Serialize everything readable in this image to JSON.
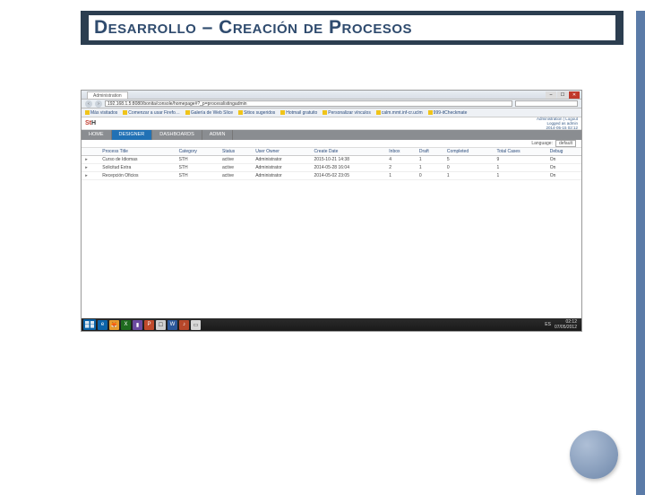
{
  "slide": {
    "title": "Desarrollo – Creación de Procesos"
  },
  "browser": {
    "tab_title": "Administration",
    "url": "192.168.1.5:8080/bonita/console/homepage#?_p=processlistingadmin",
    "search_placeholder": "Google",
    "win_min": "–",
    "win_max": "☐",
    "win_close": "✕",
    "bookmarks": [
      "Más visitados",
      "Comenzar a usar Firefo…",
      "Galería de Web Slice",
      "Sitios sugeridos",
      "Hotmail gratuito",
      "Personalizar vínculos",
      "calm.mmt.inf-cr.uclm",
      "999-itCheckmate"
    ]
  },
  "app": {
    "logo_main": "St",
    "logo_sub": "H",
    "header_link": "Administration | Logout",
    "header_user": "Logged as admin",
    "header_time": "2014-05-15 02:12",
    "nav": [
      "HOME",
      "DESIGNER",
      "DASHBOARDS",
      "ADMIN"
    ],
    "nav_active_index": 1,
    "lang_label": "Language:",
    "lang_value": "default",
    "columns": [
      "",
      "Process Title",
      "Category",
      "Status",
      "User Owner",
      "Create Date",
      "Inbox",
      "Draft",
      "Completed",
      "Total Cases",
      "Debug"
    ],
    "rows": [
      {
        "exp": "▸",
        "title": "Curso de Idiomas",
        "cat": "STH",
        "status": "active",
        "owner": "Administrator",
        "date": "2015-10-21 14:38",
        "inbox": "4",
        "draft": "1",
        "completed": "5",
        "total": "9",
        "debug": "On"
      },
      {
        "exp": "▸",
        "title": "Solicitud Extra",
        "cat": "STH",
        "status": "active",
        "owner": "Administrator",
        "date": "2014-05-28 16:04",
        "inbox": "2",
        "draft": "1",
        "completed": "0",
        "total": "1",
        "debug": "On"
      },
      {
        "exp": "▸",
        "title": "Recepción Oficios",
        "cat": "STH",
        "status": "active",
        "owner": "Administrator",
        "date": "2014-05-02 23:05",
        "inbox": "1",
        "draft": "0",
        "completed": "1",
        "total": "1",
        "debug": "On"
      }
    ]
  },
  "taskbar": {
    "icons": [
      {
        "bg": "#0b63a8",
        "glyph": "e"
      },
      {
        "bg": "#e79b2d",
        "glyph": "🦊"
      },
      {
        "bg": "#1e6b1e",
        "glyph": "X"
      },
      {
        "bg": "#6b4ba0",
        "glyph": "▮"
      },
      {
        "bg": "#c04a2b",
        "glyph": "P"
      },
      {
        "bg": "#cfcfcf",
        "glyph": "☐"
      },
      {
        "bg": "#2b579a",
        "glyph": "W"
      },
      {
        "bg": "#b7472a",
        "glyph": "♪"
      },
      {
        "bg": "#d8d8d8",
        "glyph": "▭"
      }
    ],
    "lang": "ES",
    "time": "02:12",
    "date": "07/05/2012"
  }
}
